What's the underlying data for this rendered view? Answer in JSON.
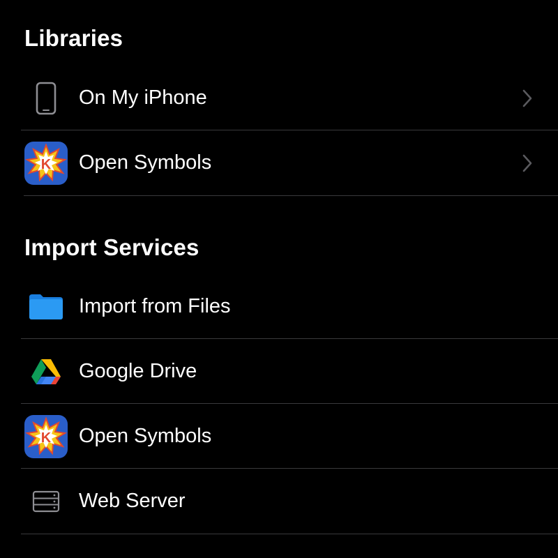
{
  "libraries": {
    "title": "Libraries",
    "items": [
      {
        "label": "On My iPhone",
        "icon": "iphone-icon",
        "has_chevron": true
      },
      {
        "label": "Open Symbols",
        "icon": "open-symbols-app-icon",
        "has_chevron": true
      }
    ]
  },
  "import_services": {
    "title": "Import Services",
    "items": [
      {
        "label": "Import from Files",
        "icon": "files-folder-icon"
      },
      {
        "label": "Google Drive",
        "icon": "google-drive-icon"
      },
      {
        "label": "Open Symbols",
        "icon": "open-symbols-app-icon"
      },
      {
        "label": "Web Server",
        "icon": "server-icon"
      }
    ]
  },
  "colors": {
    "background": "#000000",
    "text": "#ffffff",
    "separator": "#3a3a3c",
    "chevron": "#5a5a5e",
    "folder_blue": "#1f8ef1",
    "open_symbols_bg": "#2a5ec9"
  }
}
